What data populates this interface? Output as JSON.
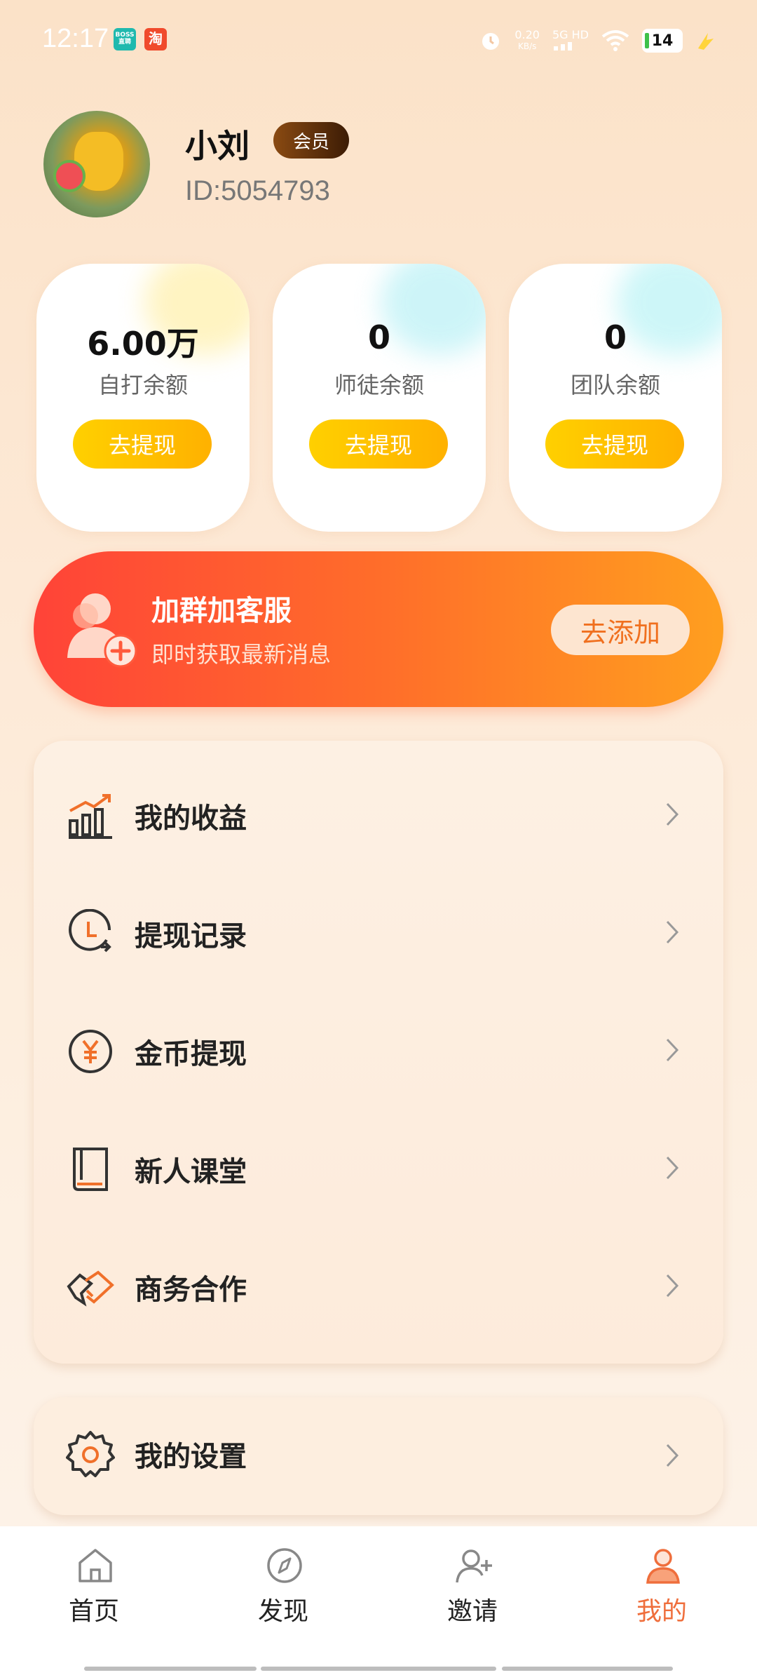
{
  "status_bar": {
    "time": "12:17",
    "boss_badge": "BOSS直聘",
    "taobao_badge": "淘",
    "net_speed_value": "0.20",
    "net_speed_unit": "KB/s",
    "network": "5G HD",
    "battery": "14"
  },
  "profile": {
    "name": "小刘",
    "badge": "会员",
    "id": "ID:5054793"
  },
  "balances": [
    {
      "value": "6.00万",
      "label": "自打余额",
      "button": "去提现"
    },
    {
      "value": "0",
      "label": "师徒余额",
      "button": "去提现"
    },
    {
      "value": "0",
      "label": "团队余额",
      "button": "去提现"
    }
  ],
  "group_banner": {
    "title": "加群加客服",
    "subtitle": "即时获取最新消息",
    "button": "去添加"
  },
  "menu": [
    {
      "label": "我的收益",
      "icon": "earnings-chart-icon"
    },
    {
      "label": "提现记录",
      "icon": "clock-record-icon"
    },
    {
      "label": "金币提现",
      "icon": "yuan-coin-icon"
    },
    {
      "label": "新人课堂",
      "icon": "book-icon"
    },
    {
      "label": "商务合作",
      "icon": "handshake-icon"
    }
  ],
  "settings": {
    "label": "我的设置",
    "icon": "gear-icon"
  },
  "bottom_nav": [
    {
      "label": "首页",
      "icon": "home-icon"
    },
    {
      "label": "发现",
      "icon": "compass-icon"
    },
    {
      "label": "邀请",
      "icon": "invite-user-icon"
    },
    {
      "label": "我的",
      "icon": "user-icon",
      "active": true
    }
  ],
  "colors": {
    "accent_orange": "#ef6e3c",
    "button_yellow": "#ffc400",
    "banner_red": "#ff4338",
    "banner_orange": "#ff9f1f"
  }
}
